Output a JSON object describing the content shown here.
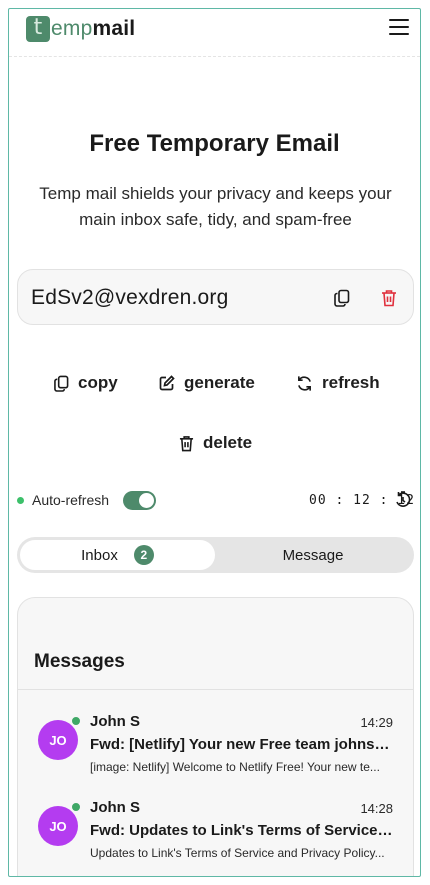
{
  "brand": {
    "logo_letter": "t",
    "logo_light": "emp",
    "logo_bold": "mail",
    "color": "#4e8a6b"
  },
  "header": {
    "menu_icon": "hamburger-menu-icon"
  },
  "hero": {
    "title": "Free Temporary Email",
    "subtitle": "Temp mail shields your privacy and keeps your main inbox safe, tidy, and spam-free"
  },
  "email": {
    "address": "EdSv2@vexdren.org",
    "copy_icon": "copy-icon",
    "delete_icon": "trash-icon",
    "delete_color": "#e0303d"
  },
  "actions": {
    "copy": "copy",
    "generate": "generate",
    "refresh": "refresh",
    "delete": "delete"
  },
  "auto_refresh": {
    "label": "Auto-refresh",
    "enabled": true,
    "status_color": "#3cc06a"
  },
  "timer": {
    "h": "00",
    "m": "12",
    "s": "12"
  },
  "tabs": {
    "inbox_label": "Inbox",
    "inbox_count": "2",
    "message_label": "Message",
    "active": "Inbox"
  },
  "messages": {
    "title": "Messages",
    "items": [
      {
        "initials": "JO",
        "sender": "John S",
        "time": "14:29",
        "subject": "Fwd: [Netlify] Your new Free team johnsha...",
        "preview": "[image: Netlify] Welcome to Netlify Free! Your new te..."
      },
      {
        "initials": "JO",
        "sender": "John S",
        "time": "14:28",
        "subject": "Fwd: Updates to Link's Terms of Service an...",
        "preview": "Updates to Link's Terms of Service and Privacy Policy..."
      }
    ],
    "avatar_color": "#b43cf0"
  }
}
